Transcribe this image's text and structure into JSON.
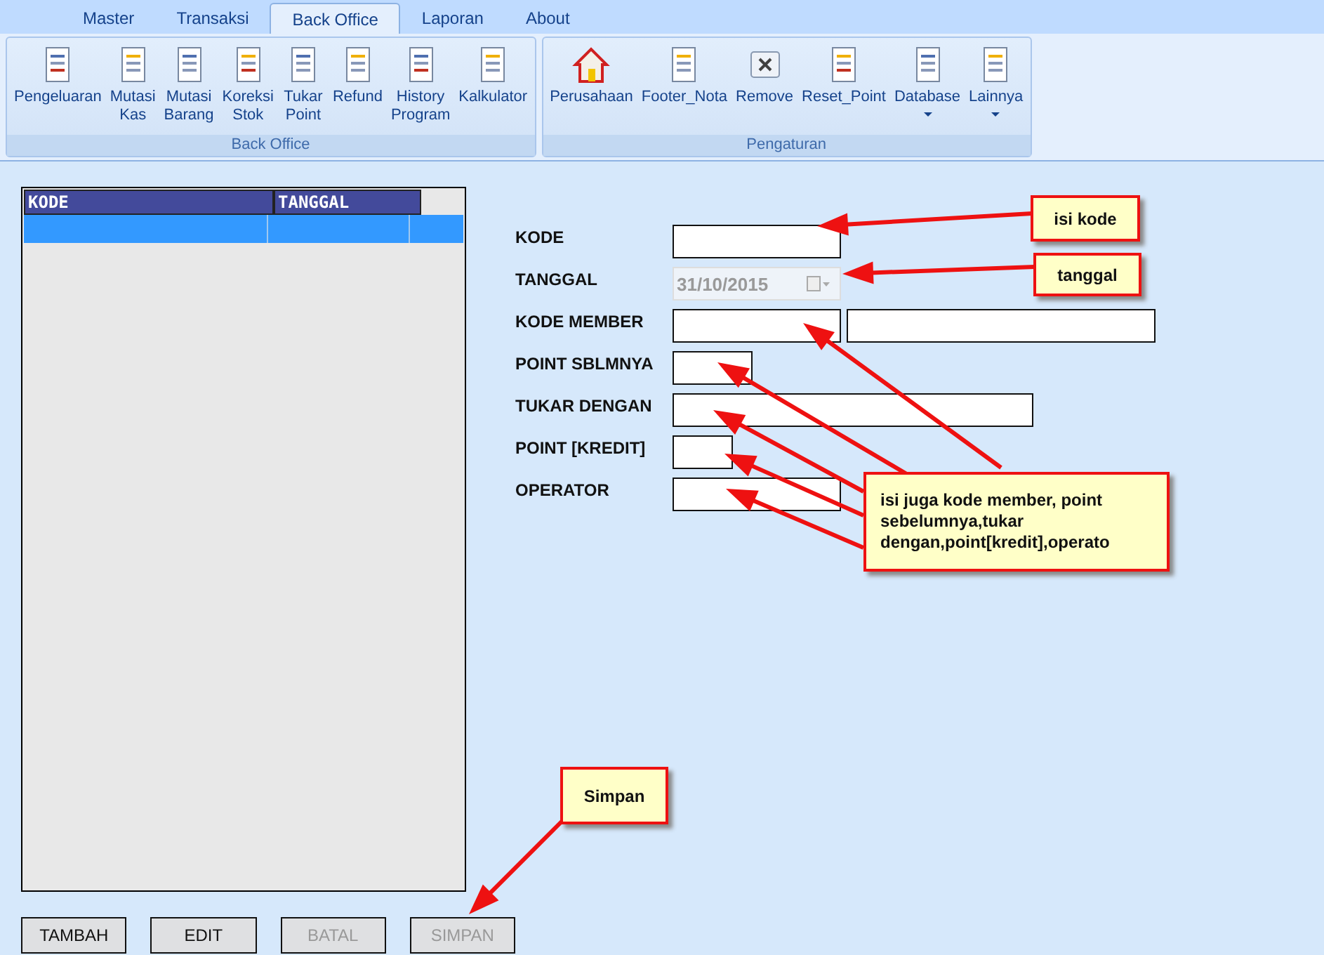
{
  "tabs": [
    {
      "label": "Master",
      "selected": false
    },
    {
      "label": "Transaksi",
      "selected": false
    },
    {
      "label": "Back Office",
      "selected": true
    },
    {
      "label": "Laporan",
      "selected": false
    },
    {
      "label": "About",
      "selected": false
    }
  ],
  "ribbon_groups": [
    {
      "title": "Back Office",
      "items": [
        {
          "label": "Pengeluaran",
          "dropdown": false
        },
        {
          "label": "Mutasi\nKas",
          "dropdown": false
        },
        {
          "label": "Mutasi\nBarang",
          "dropdown": false
        },
        {
          "label": "Koreksi\nStok",
          "dropdown": false
        },
        {
          "label": "Tukar\nPoint",
          "dropdown": false
        },
        {
          "label": "Refund",
          "dropdown": false
        },
        {
          "label": "History\nProgram",
          "dropdown": false
        },
        {
          "label": "Kalkulator",
          "dropdown": false
        }
      ]
    },
    {
      "title": "Pengaturan",
      "items": [
        {
          "label": "Perusahaan",
          "dropdown": false
        },
        {
          "label": "Footer_Nota",
          "dropdown": false
        },
        {
          "label": "Remove",
          "dropdown": false
        },
        {
          "label": "Reset_Point",
          "dropdown": false
        },
        {
          "label": "Database",
          "dropdown": true
        },
        {
          "label": "Lainnya",
          "dropdown": true
        }
      ]
    }
  ],
  "table": {
    "columns": [
      "KODE",
      "TANGGAL"
    ],
    "rows": [
      {
        "selected": true
      }
    ]
  },
  "form": [
    {
      "label": "KODE",
      "fields": [
        {
          "disabled": false
        }
      ]
    },
    {
      "label": "TANGGAL",
      "fields": [
        {
          "value": "31/10/2015",
          "disabled": true,
          "kind": "date"
        }
      ]
    },
    {
      "label": "KODE MEMBER",
      "fields": [
        {
          "disabled": false
        },
        {
          "disabled": false
        }
      ]
    },
    {
      "label": "POINT SBLMNYA",
      "fields": [
        {
          "disabled": false
        }
      ]
    },
    {
      "label": "TUKAR DENGAN",
      "fields": [
        {
          "disabled": false
        }
      ]
    },
    {
      "label": "POINT [KREDIT]",
      "fields": [
        {
          "disabled": false
        }
      ]
    },
    {
      "label": "OPERATOR",
      "fields": [
        {
          "disabled": false
        }
      ]
    }
  ],
  "buttons": [
    {
      "label": "TAMBAH",
      "disabled": false
    },
    {
      "label": "EDIT",
      "disabled": false
    },
    {
      "label": "BATAL",
      "disabled": true
    },
    {
      "label": "SIMPAN",
      "disabled": true
    }
  ],
  "callouts": [
    "isi kode",
    "tanggal",
    "isi juga kode member, point sebelumnya,tukar dengan,point[kredit],operato",
    "Simpan"
  ]
}
